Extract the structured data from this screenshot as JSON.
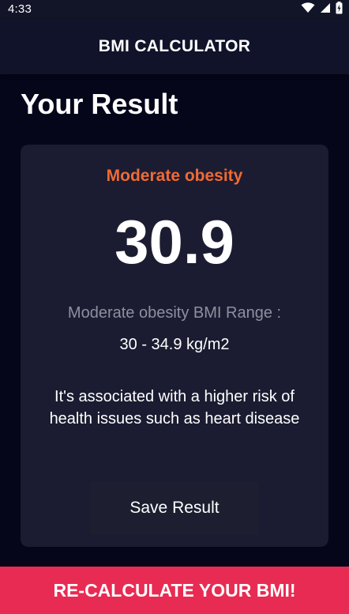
{
  "status_bar": {
    "time": "4:33",
    "icons": [
      "wifi-icon",
      "cellular-signal-icon",
      "battery-icon"
    ]
  },
  "app_bar": {
    "title": "BMI CALCULATOR"
  },
  "page": {
    "title": "Your Result"
  },
  "result": {
    "status": "Moderate obesity",
    "bmi": "30.9",
    "range_label": "Moderate obesity BMI Range :",
    "range_value": "30 - 34.9 kg/m2",
    "interpretation": "It's associated with a higher risk of health issues such as heart disease",
    "save_label": "Save Result"
  },
  "footer": {
    "recalculate_label": "RE-CALCULATE YOUR BMI!"
  },
  "colors": {
    "background": "#05061a",
    "app_bar": "#11132a",
    "card": "#1b1c31",
    "status_accent": "#f06a34",
    "recalculate_button": "#e82b53"
  }
}
